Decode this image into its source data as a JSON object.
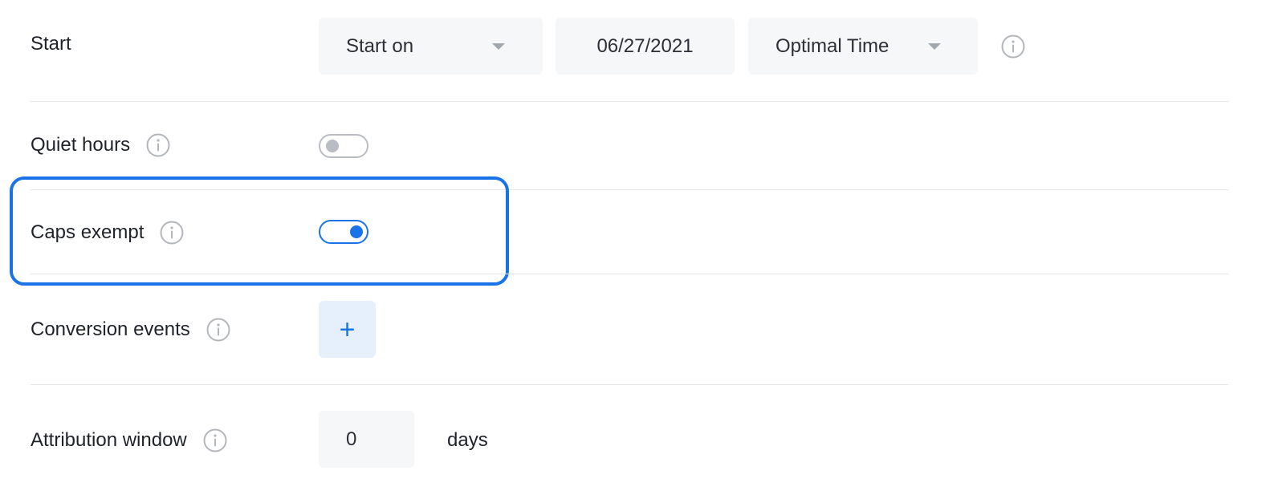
{
  "start": {
    "label": "Start",
    "mode_select": {
      "value": "Start on"
    },
    "date_input": {
      "value": "06/27/2021"
    },
    "time_select": {
      "value": "Optimal Time"
    }
  },
  "quiet_hours": {
    "label": "Quiet hours",
    "enabled": false
  },
  "caps_exempt": {
    "label": "Caps exempt",
    "enabled": true,
    "highlighted": true
  },
  "conversion_events": {
    "label": "Conversion events",
    "add_button_symbol": "+"
  },
  "attribution_window": {
    "label": "Attribution window",
    "value": "0",
    "unit": "days"
  },
  "colors": {
    "accent": "#1a73e8",
    "field_bg": "#f6f7f9",
    "divider": "#e4e6ea",
    "toggle_off": "#b9bcc2"
  },
  "icons": {
    "info": "info-circle-icon",
    "dropdown": "caret-down-icon"
  }
}
